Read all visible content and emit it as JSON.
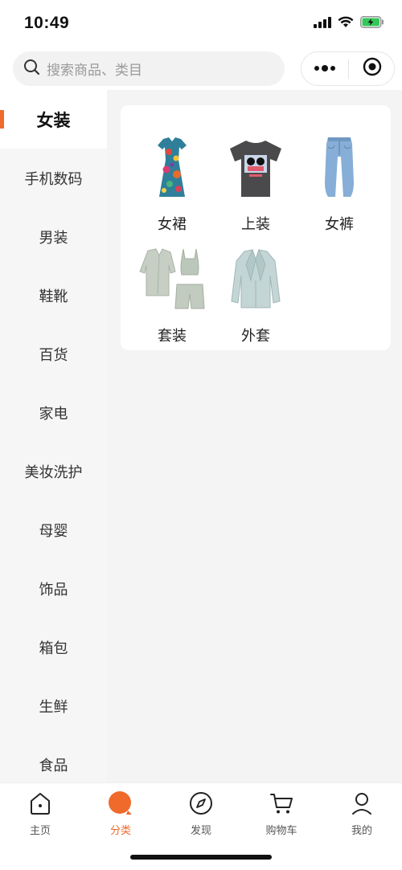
{
  "status_bar": {
    "time": "10:49",
    "icons": [
      "cellular-signal-icon",
      "wifi-icon",
      "battery-charging-icon"
    ],
    "battery_color": "#34c759"
  },
  "search": {
    "placeholder": "搜索商品、类目",
    "icon": "search-icon"
  },
  "capsule": {
    "more_icon": "more-dots-icon",
    "close_icon": "target-circle-icon"
  },
  "sidebar": {
    "active_index": 0,
    "accent_color": "#f06a2b",
    "items": [
      {
        "label": "女装"
      },
      {
        "label": "手机数码"
      },
      {
        "label": "男装"
      },
      {
        "label": "鞋靴"
      },
      {
        "label": "百货"
      },
      {
        "label": "家电"
      },
      {
        "label": "美妆洗护"
      },
      {
        "label": "母婴"
      },
      {
        "label": "饰品"
      },
      {
        "label": "箱包"
      },
      {
        "label": "生鲜"
      },
      {
        "label": "食品"
      }
    ]
  },
  "subcategories": [
    {
      "label": "女裙",
      "icon": "floral-dress-image"
    },
    {
      "label": "上装",
      "icon": "graphic-tshirt-image"
    },
    {
      "label": "女裤",
      "icon": "jeans-image"
    },
    {
      "label": "套装",
      "icon": "blazer-set-image"
    },
    {
      "label": "外套",
      "icon": "coat-image"
    }
  ],
  "tabbar": {
    "active_index": 1,
    "accent_color": "#f06a2b",
    "tabs": [
      {
        "label": "主页",
        "icon": "home-icon"
      },
      {
        "label": "分类",
        "icon": "category-search-icon"
      },
      {
        "label": "发现",
        "icon": "compass-icon"
      },
      {
        "label": "购物车",
        "icon": "cart-icon"
      },
      {
        "label": "我的",
        "icon": "user-icon"
      }
    ]
  }
}
